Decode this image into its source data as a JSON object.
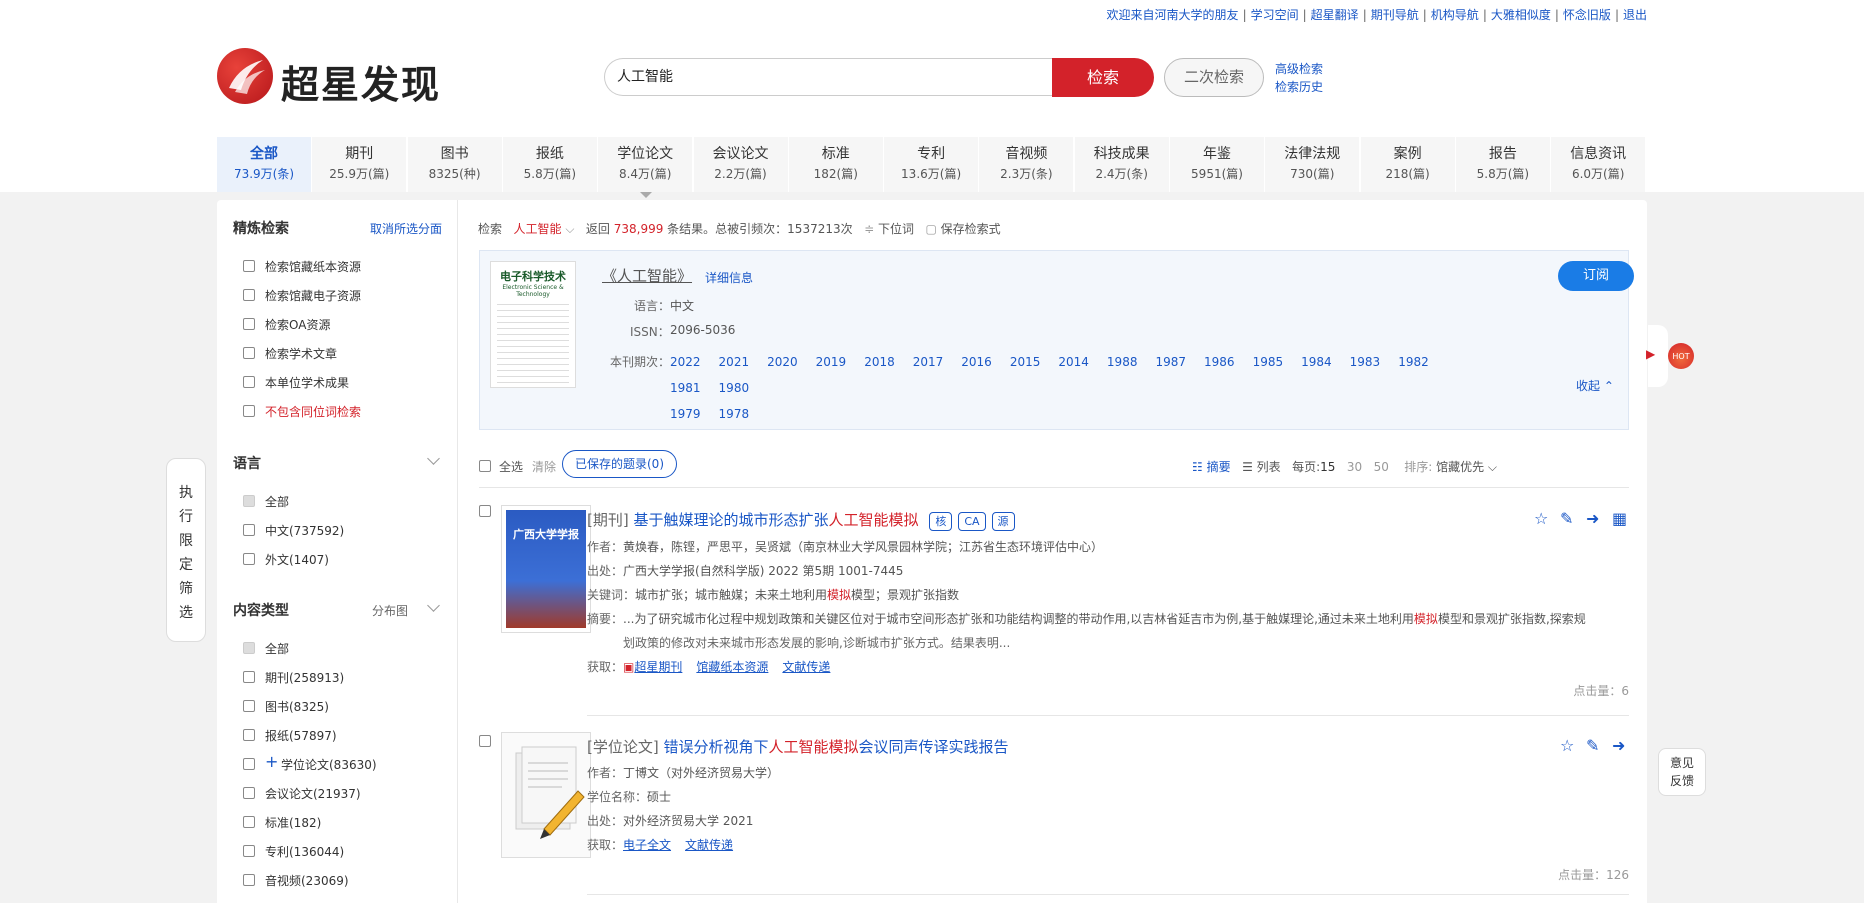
{
  "top_links": [
    "欢迎来自河南大学的朋友",
    "学习空间",
    "超星翻译",
    "期刊导航",
    "机构导航",
    "大雅相似度",
    "怀念旧版",
    "退出"
  ],
  "logo_text": "超星发现",
  "search": {
    "value": "人工智能",
    "button": "检索",
    "second_button": "二次检索",
    "advanced": "高级检索",
    "history": "检索历史"
  },
  "tabs": [
    {
      "label": "全部",
      "count": "73.9万(条)"
    },
    {
      "label": "期刊",
      "count": "25.9万(篇)"
    },
    {
      "label": "图书",
      "count": "8325(种)"
    },
    {
      "label": "报纸",
      "count": "5.8万(篇)"
    },
    {
      "label": "学位论文",
      "count": "8.4万(篇)"
    },
    {
      "label": "会议论文",
      "count": "2.2万(篇)"
    },
    {
      "label": "标准",
      "count": "182(篇)"
    },
    {
      "label": "专利",
      "count": "13.6万(篇)"
    },
    {
      "label": "音视频",
      "count": "2.3万(条)"
    },
    {
      "label": "科技成果",
      "count": "2.4万(条)"
    },
    {
      "label": "年鉴",
      "count": "5951(篇)"
    },
    {
      "label": "法律法规",
      "count": "730(篇)"
    },
    {
      "label": "案例",
      "count": "218(篇)"
    },
    {
      "label": "报告",
      "count": "5.8万(篇)"
    },
    {
      "label": "信息资讯",
      "count": "6.0万(篇)"
    }
  ],
  "sidebar": {
    "refine_title": "精炼检索",
    "cancel_link": "取消所选分面",
    "refine_options": [
      "检索馆藏纸本资源",
      "检索馆藏电子资源",
      "检索OA资源",
      "检索学术文章",
      "本单位学术成果",
      "不包含同位词检索"
    ],
    "lang_title": "语言",
    "lang_options": [
      "全部",
      "中文(737592)",
      "外文(1407)"
    ],
    "type_title": "内容类型",
    "type_link": "分布图",
    "type_options": [
      "全部",
      "期刊(258913)",
      "图书(8325)",
      "报纸(57897)",
      "学位论文(83630)",
      "会议论文(21937)",
      "标准(182)",
      "专利(136044)",
      "音视频(23069)"
    ]
  },
  "result_bar": {
    "label": "检索",
    "keyword": "人工智能",
    "return_prefix": "返回",
    "count": "738,999",
    "return_suffix": "条结果。总被引频次：1537213次",
    "sub_term": "下位词",
    "save": "保存检索式"
  },
  "journal": {
    "cover_title": "电子科学技术",
    "cover_subtitle": "Electronic Science & Technology",
    "title": "《人工智能》",
    "details": "详细信息",
    "lang_label": "语言：",
    "lang": "中文",
    "issn_label": "ISSN：",
    "issn": "2096-5036",
    "issues_label": "本刊期次：",
    "years": [
      "2022",
      "2021",
      "2020",
      "2019",
      "2018",
      "2017",
      "2016",
      "2015",
      "2014",
      "1988",
      "1987",
      "1986",
      "1985",
      "1984",
      "1983",
      "1982",
      "1981",
      "1980",
      "1979",
      "1978"
    ],
    "subscribe": "订阅",
    "collapse": "收起"
  },
  "list_bar": {
    "select_all": "全选",
    "clear": "清除",
    "saved": "已保存的题录(0)",
    "abstract": "摘要",
    "list": "列表",
    "per_page_label": "每页:",
    "per_page": [
      "15",
      "30",
      "50"
    ],
    "sort_label": "排序:",
    "sort_value": "馆藏优先"
  },
  "results": [
    {
      "type": "[期刊]",
      "title_pre": "基于触媒理论的城市形态扩张",
      "title_hl": "人工智能模拟",
      "badges": [
        "核",
        "CA",
        "源"
      ],
      "cover_title": "广西大学学报",
      "author_label": "作者：",
      "author": "黄焕春，陈铿，严思平，吴贤斌（南京林业大学风景园林学院；江苏省生态环境评估中心）",
      "source_label": "出处：",
      "source": "广西大学学报(自然科学版) 2022 第5期  1001-7445",
      "kw_label": "关键词：",
      "kw_pre": "城市扩张；城市触媒；未来土地利用",
      "kw_hl": "模拟",
      "kw_post": "模型；景观扩张指数",
      "abs_label": "摘要：",
      "abs1_pre": "...为了研究城市化过程中规划政策和关键区位对于城市空间形态扩张和功能结构调整的带动作用,以吉林省延吉市为例,基于触媒理论,通过未来土地利用",
      "abs1_hl": "模拟",
      "abs1_post": "模型和景观扩张指数,探索规",
      "abs2": "划政策的修改对未来城市形态发展的影响,诊断城市扩张方式。结果表明...",
      "get_label": "获取：",
      "links": [
        "超星期刊",
        "馆藏纸本资源",
        "文献传递"
      ],
      "clicks": "点击量：6"
    },
    {
      "type": "[学位论文]",
      "title_pre": "错误分析视角下",
      "title_hl": "人工智能模拟",
      "title_post": "会议同声传译实践报告",
      "author_label": "作者：",
      "author": "丁博文（对外经济贸易大学）",
      "degree_label": "学位名称：",
      "degree": "硕士",
      "source_label": "出处：",
      "source": "对外经济贸易大学 2021",
      "get_label": "获取：",
      "links": [
        "电子全文",
        "文献传递"
      ],
      "clicks": "点击量：126"
    }
  ],
  "side": {
    "exec": [
      "执",
      "行",
      "限",
      "定",
      "筛",
      "选"
    ],
    "hot": "HOT",
    "feedback1": "意见",
    "feedback2": "反馈"
  }
}
